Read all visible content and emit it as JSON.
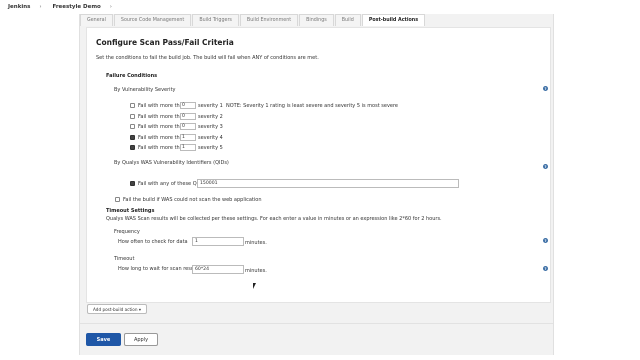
{
  "breadcrumbs": [
    {
      "label": "Jenkins"
    },
    {
      "label": "Freestyle Demo"
    }
  ],
  "breadcrumb_separator": "›",
  "tabs": [
    {
      "label": "General"
    },
    {
      "label": "Source Code Management"
    },
    {
      "label": "Build Triggers"
    },
    {
      "label": "Build Environment"
    },
    {
      "label": "Bindings"
    },
    {
      "label": "Build"
    },
    {
      "label": "Post-build Actions",
      "active": true
    }
  ],
  "section": {
    "title": "Configure Scan Pass/Fail Criteria",
    "description": "Set the conditions to fail the build job. The build will fail when ANY of conditions are met.",
    "failure_conditions_label": "Failure Conditions",
    "by_severity_label": "By Vulnerability Severity",
    "severity_rows": [
      {
        "label": "Fail with more than",
        "value": "0",
        "severity": "severity 1",
        "checked": false
      },
      {
        "label": "Fail with more than",
        "value": "0",
        "severity": "severity 2",
        "checked": false
      },
      {
        "label": "Fail with more than",
        "value": "0",
        "severity": "severity 3",
        "checked": false
      },
      {
        "label": "Fail with more than",
        "value": "1",
        "severity": "severity 4",
        "checked": true
      },
      {
        "label": "Fail with more than",
        "value": "1",
        "severity": "severity 5",
        "checked": true
      }
    ],
    "severity_note": "NOTE: Severity 1 rating is least severe and severity 5 is most severe",
    "by_qid_label": "By Qualys WAS Vulnerability Identifiers (QIDs)",
    "qid_row": {
      "label": "Fail with any of these QIDs:",
      "value": "150001",
      "checked": true
    },
    "fail_if_not_scan": {
      "label": "Fail the build if WAS could not scan the web application",
      "checked": false
    },
    "timeout_title": "Timeout Settings",
    "timeout_description": "Qualys WAS Scan results will be collected per these settings. For each enter a value in minutes or an expression like 2*60 for 2 hours.",
    "frequency": {
      "title": "Frequency",
      "label": "How often to check for data",
      "value": "1",
      "unit": "minutes."
    },
    "timeout": {
      "title": "Timeout",
      "label": "How long to wait for scan results",
      "value": "60*24",
      "unit": "minutes."
    }
  },
  "add_post_build_label": "Add post-build action ▾",
  "buttons": {
    "save": "Save",
    "apply": "Apply"
  },
  "help_glyph": "?",
  "colors": {
    "primary": "#1f57a7",
    "help": "#3b6ea5"
  }
}
